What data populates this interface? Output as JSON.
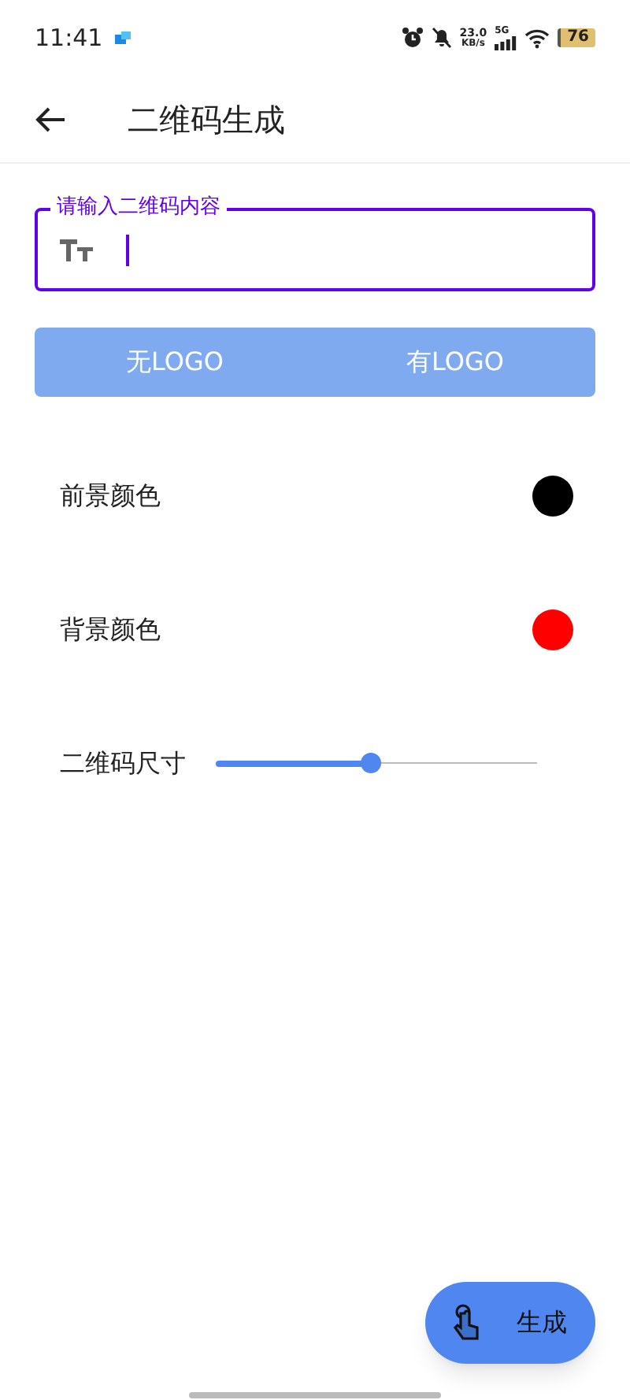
{
  "status_bar": {
    "time": "11:41",
    "speed": "23.0",
    "speed_unit": "KB/s",
    "network": "5G",
    "battery": "76"
  },
  "app_bar": {
    "title": "二维码生成"
  },
  "content_field": {
    "label": "请输入二维码内容"
  },
  "logo_options": [
    "无LOGO",
    "有LOGO"
  ],
  "settings": [
    {
      "kind": "color",
      "label": "前景颜色",
      "color": "#000000"
    },
    {
      "kind": "color",
      "label": "背景颜色",
      "color": "#ff0000"
    },
    {
      "kind": "slider",
      "label": "二维码尺寸",
      "level": 0.48
    }
  ],
  "fab": {
    "label": "生成"
  }
}
